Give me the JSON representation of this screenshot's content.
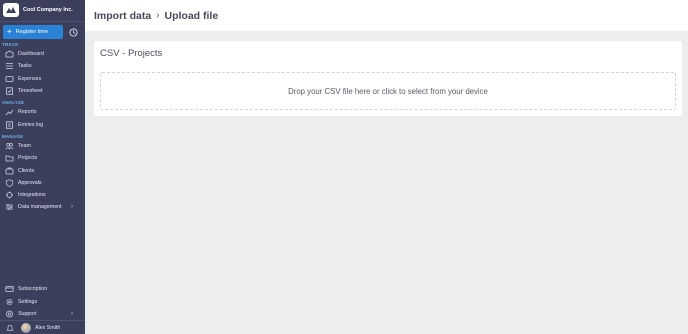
{
  "brand": {
    "name": "Cool Company Inc."
  },
  "register": {
    "label": "Register time"
  },
  "sections": {
    "track": "TRACK",
    "analyze": "ANALYZE",
    "manage": "MANAGE"
  },
  "nav": {
    "dashboard": "Dashboard",
    "tasks": "Tasks",
    "expenses": "Expenses",
    "timesheet": "Timesheet",
    "reports": "Reports",
    "entries_log": "Entries log",
    "team": "Team",
    "projects": "Projects",
    "clients": "Clients",
    "approvals": "Approvals",
    "integrations": "Integrations",
    "data_management": "Data management"
  },
  "bottom": {
    "subscription": "Subscription",
    "settings": "Settings",
    "support": "Support",
    "user_name": "Alex Smith"
  },
  "breadcrumb": {
    "parent": "Import data",
    "current": "Upload file"
  },
  "card": {
    "title": "CSV - Projects",
    "dropzone_text": "Drop your CSV file here or click to select from your device"
  },
  "colors": {
    "sidebar": "#3b3f5c",
    "accent": "#2a82d6",
    "section_label": "#6fb5f0",
    "background": "#ecedef"
  }
}
